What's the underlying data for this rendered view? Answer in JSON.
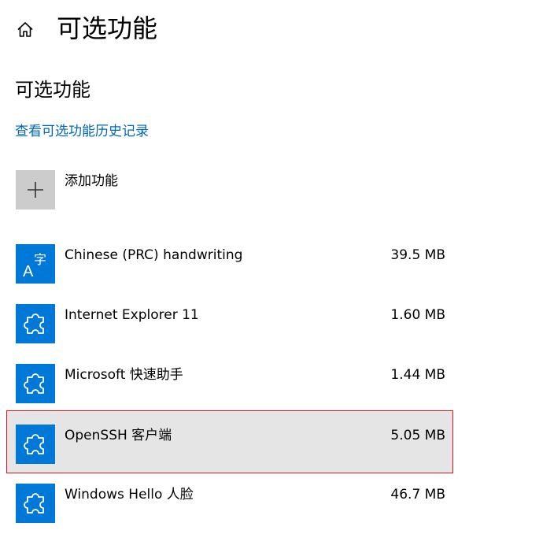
{
  "header": {
    "home_icon": "home-icon",
    "title": "可选功能"
  },
  "section": {
    "title": "可选功能",
    "history_link": "查看可选功能历史记录"
  },
  "add_feature": {
    "icon": "plus-icon",
    "label": "添加功能"
  },
  "features": [
    {
      "name": "Chinese (PRC) handwriting",
      "size": "39.5 MB",
      "icon": "language-icon",
      "selected": false
    },
    {
      "name": "Internet Explorer 11",
      "size": "1.60 MB",
      "icon": "puzzle-icon",
      "selected": false
    },
    {
      "name": "Microsoft 快速助手",
      "size": "1.44 MB",
      "icon": "puzzle-icon",
      "selected": false
    },
    {
      "name": "OpenSSH 客户端",
      "size": "5.05 MB",
      "icon": "puzzle-icon",
      "selected": true
    },
    {
      "name": "Windows Hello 人脸",
      "size": "46.7 MB",
      "icon": "puzzle-icon",
      "selected": false
    }
  ],
  "colors": {
    "accent": "#0078d7",
    "link": "#0067b8",
    "selected_bg": "#e5e5e5",
    "selected_border": "#e81123",
    "add_tile": "#cccccc"
  }
}
